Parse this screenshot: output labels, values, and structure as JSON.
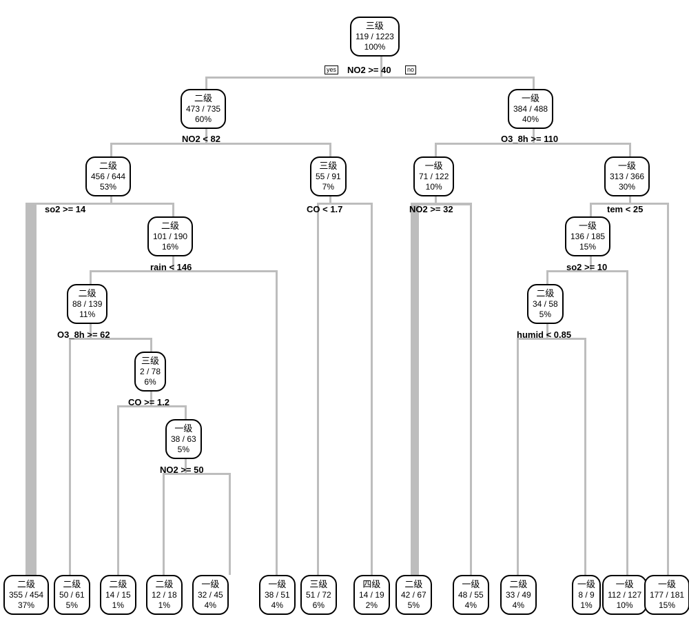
{
  "yesLabel": "yes",
  "noLabel": "no",
  "conditions": {
    "root": "NO2 >= 40",
    "l": "NO2 < 82",
    "r": "O3_8h >= 110",
    "ll": "so2 >= 14",
    "lr": "CO < 1.7",
    "rl": "NO2 >= 32",
    "rr": "tem < 25",
    "llr": "rain < 146",
    "rrl": "so2 >= 10",
    "llrl": "O3_8h >= 62",
    "rrll": "humid < 0.85",
    "llrlr": "CO >= 1.2",
    "llrlrr": "NO2 >= 50"
  },
  "nodes": {
    "root": {
      "label": "三级",
      "frac": "119 / 1223",
      "pct": "100%"
    },
    "l": {
      "label": "二级",
      "frac": "473 / 735",
      "pct": "60%"
    },
    "r": {
      "label": "一级",
      "frac": "384 / 488",
      "pct": "40%"
    },
    "ll": {
      "label": "二级",
      "frac": "456 / 644",
      "pct": "53%"
    },
    "lr": {
      "label": "三级",
      "frac": "55 / 91",
      "pct": "7%"
    },
    "rl": {
      "label": "一级",
      "frac": "71 / 122",
      "pct": "10%"
    },
    "rr": {
      "label": "一级",
      "frac": "313 / 366",
      "pct": "30%"
    },
    "llr": {
      "label": "二级",
      "frac": "101 / 190",
      "pct": "16%"
    },
    "rrl": {
      "label": "一级",
      "frac": "136 / 185",
      "pct": "15%"
    },
    "llrl": {
      "label": "二级",
      "frac": "88 / 139",
      "pct": "11%"
    },
    "rrll": {
      "label": "二级",
      "frac": "34 / 58",
      "pct": "5%"
    },
    "llrlr": {
      "label": "三级",
      "frac": "2 / 78",
      "pct": "6%"
    },
    "llrlrr": {
      "label": "一级",
      "frac": "38 / 63",
      "pct": "5%"
    },
    "leaf1": {
      "label": "二级",
      "frac": "355 / 454",
      "pct": "37%"
    },
    "leaf2": {
      "label": "二级",
      "frac": "50 / 61",
      "pct": "5%"
    },
    "leaf3": {
      "label": "二级",
      "frac": "14 / 15",
      "pct": "1%"
    },
    "leaf4": {
      "label": "二级",
      "frac": "12 / 18",
      "pct": "1%"
    },
    "leaf5": {
      "label": "一级",
      "frac": "32 / 45",
      "pct": "4%"
    },
    "leaf6": {
      "label": "一级",
      "frac": "38 / 51",
      "pct": "4%"
    },
    "leaf7": {
      "label": "三级",
      "frac": "51 / 72",
      "pct": "6%"
    },
    "leaf8": {
      "label": "四级",
      "frac": "14 / 19",
      "pct": "2%"
    },
    "leaf9": {
      "label": "二级",
      "frac": "42 / 67",
      "pct": "5%"
    },
    "leaf10": {
      "label": "一级",
      "frac": "48 / 55",
      "pct": "4%"
    },
    "leaf11": {
      "label": "二级",
      "frac": "33 / 49",
      "pct": "4%"
    },
    "leaf12": {
      "label": "一级",
      "frac": "8 / 9",
      "pct": "1%"
    },
    "leaf13": {
      "label": "一级",
      "frac": "112 / 127",
      "pct": "10%"
    },
    "leaf14": {
      "label": "一级",
      "frac": "177 / 181",
      "pct": "15%"
    }
  }
}
